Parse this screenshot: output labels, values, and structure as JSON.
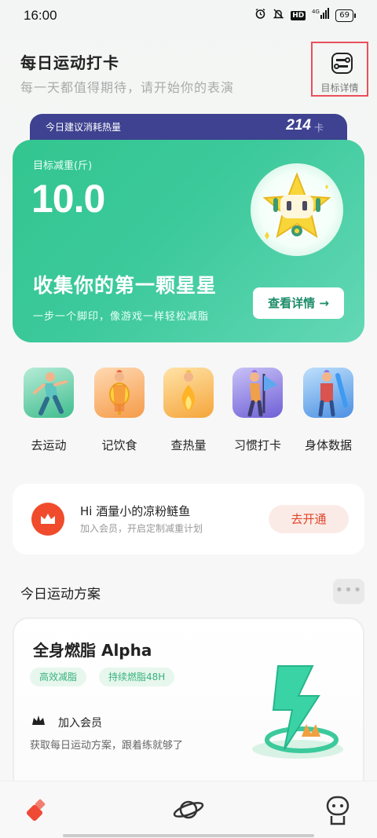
{
  "status_bar": {
    "time": "16:00",
    "icons": [
      "alarm-icon",
      "mute-icon",
      "hd-badge",
      "signal-4g-icon",
      "battery-icon"
    ],
    "hd": "HD",
    "network": "4G",
    "battery": "69"
  },
  "header": {
    "title": "每日运动打卡",
    "subtitle": "每一天都值得期待，请开始你的表演",
    "goal_button_label": "目标详情"
  },
  "calorie_strip": {
    "label": "今日建议消耗热量",
    "value": "214",
    "unit": "卡"
  },
  "hero": {
    "weight_label": "目标减重(斤)",
    "weight_value": "10.0",
    "headline": "收集你的第一颗星星",
    "subline": "一步一个脚印，像游戏一样轻松减脂",
    "button_label": "查看详情 →",
    "colors": {
      "bg_start": "#33c590",
      "bg_end": "#64d8b6",
      "button_text": "#1d8d69"
    }
  },
  "shortcuts": [
    {
      "label": "去运动",
      "icon": "exercise-illustration"
    },
    {
      "label": "记饮食",
      "icon": "diet-illustration"
    },
    {
      "label": "查热量",
      "icon": "calorie-illustration"
    },
    {
      "label": "习惯打卡",
      "icon": "habit-illustration"
    },
    {
      "label": "身体数据",
      "icon": "body-data-illustration"
    }
  ],
  "member": {
    "greeting": "Hi 酒量小的凉粉鲢鱼",
    "desc": "加入会员，开启定制减重计划",
    "button_label": "去开通",
    "accent": "#f04b2c"
  },
  "plan": {
    "section_title": "今日运动方案",
    "more_label": "•••",
    "name": "全身燃脂 Alpha",
    "tags": [
      "高效减脂",
      "持续燃脂48H"
    ],
    "join_title": "加入会员",
    "join_desc": "获取每日运动方案，跟着练就够了"
  },
  "tabbar": {
    "tabs": [
      "home-tab-icon",
      "explore-planet-icon",
      "profile-robot-icon"
    ],
    "active": 0
  }
}
